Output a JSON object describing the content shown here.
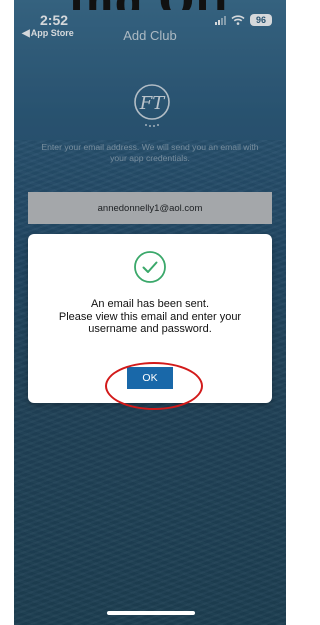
{
  "page_fragment": {
    "text": "ing Off"
  },
  "status_bar": {
    "time": "2:52",
    "back_app_label": "App Store",
    "battery": "96"
  },
  "nav": {
    "title": "Add Club",
    "back_label": "Back"
  },
  "logo": {
    "text": "FT"
  },
  "instructions": {
    "text": "Enter your email address. We will send you an email with your app credentials."
  },
  "email_field": {
    "value": "annedonnelly1@aol.com"
  },
  "dialog": {
    "message_line1": "An email has been sent.",
    "message_line2": "Please view this email and enter your",
    "message_line3": "username and password.",
    "ok_label": "OK"
  },
  "colors": {
    "background": "#2d5c7c",
    "button": "#1968a9",
    "check": "#3aa86a",
    "annotation": "#d21a1a"
  }
}
